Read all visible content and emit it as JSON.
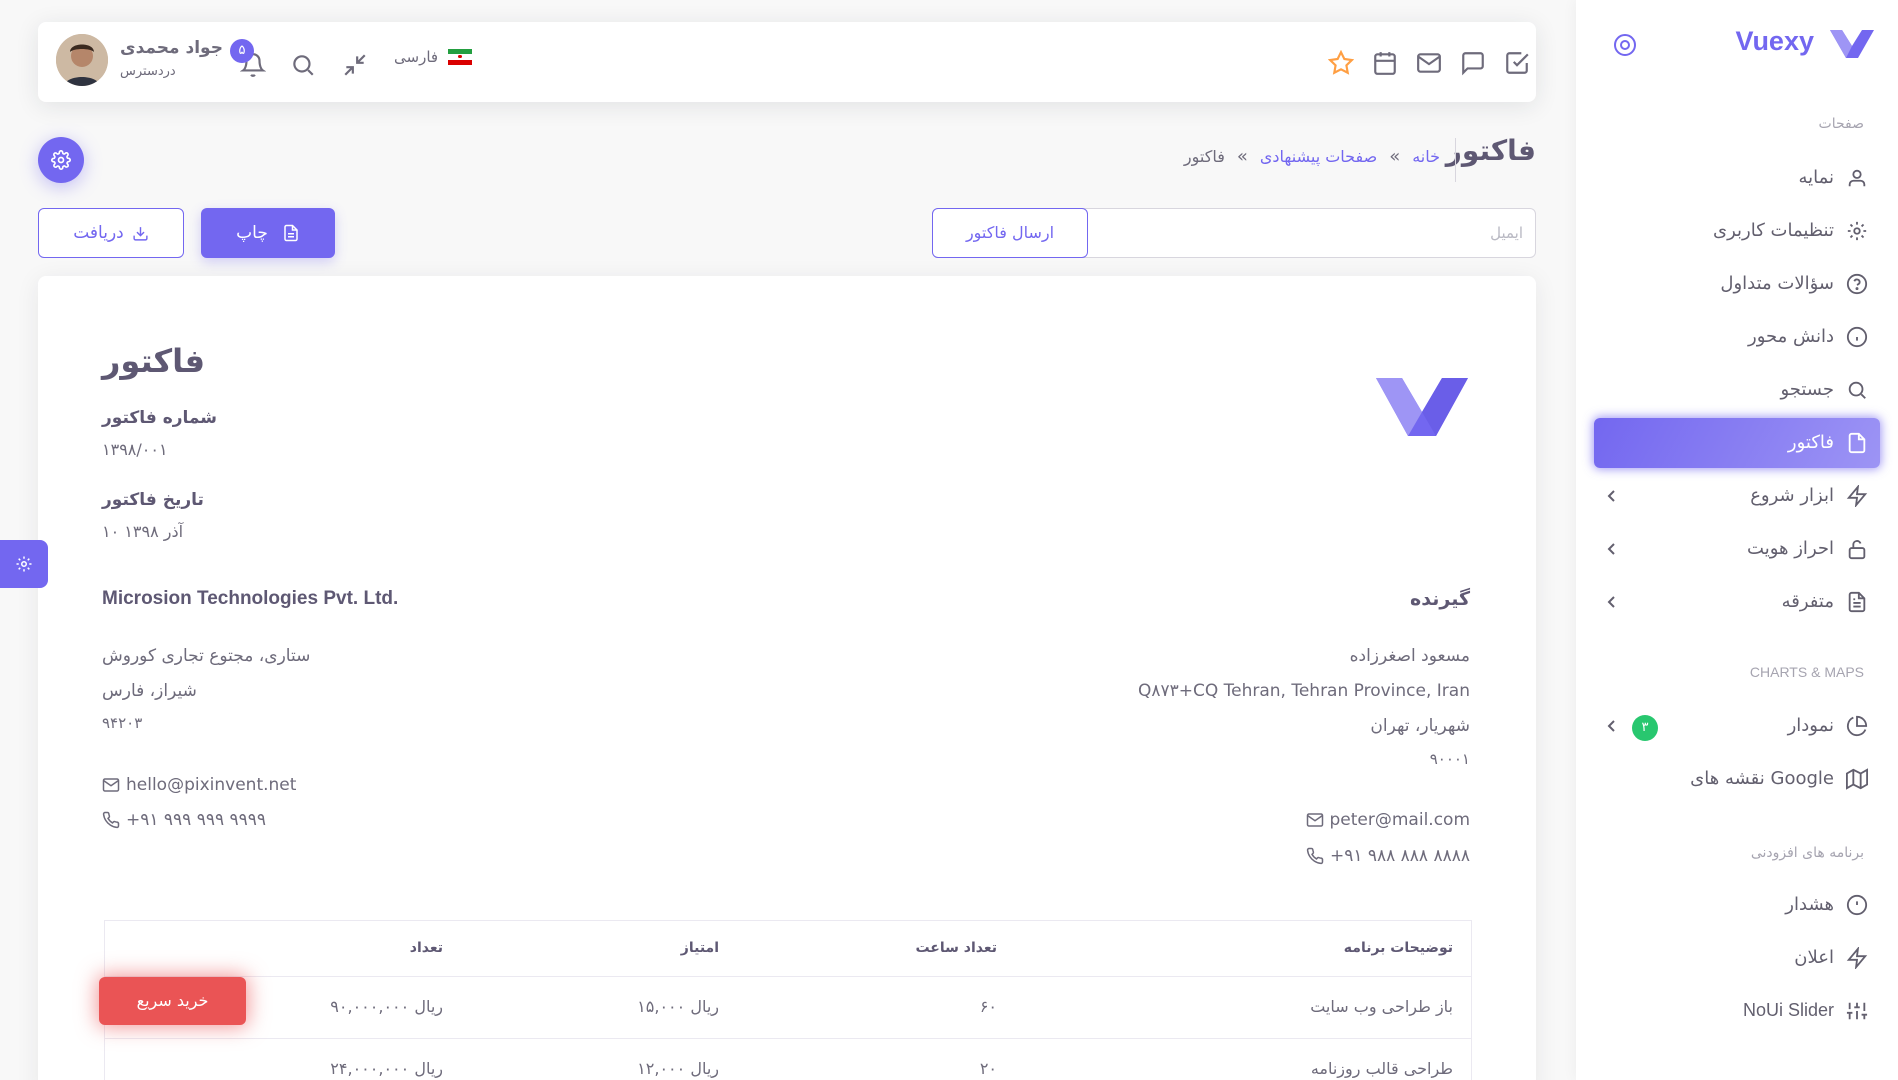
{
  "sidebar": {
    "brand": "Vuexy",
    "sections": {
      "pages": "صفحات",
      "charts": "CHARTS & MAPS",
      "extensions": "برنامه های افزودنی"
    },
    "items": [
      {
        "label": "نمایه"
      },
      {
        "label": "تنظیمات کاربری"
      },
      {
        "label": "سؤالات متداول"
      },
      {
        "label": "دانش محور"
      },
      {
        "label": "جستجو"
      },
      {
        "label": "فاکتور"
      },
      {
        "label": "ابزار شروع"
      },
      {
        "label": "احراز هویت"
      },
      {
        "label": "متفرقه"
      },
      {
        "label": "نمودار",
        "badge": "۳"
      },
      {
        "label": "نقشه های Google"
      },
      {
        "label": "هشدار"
      },
      {
        "label": "اعلان"
      },
      {
        "label": "NoUi Slider"
      }
    ]
  },
  "navbar": {
    "user_name": "جواد محمدی",
    "user_status": "دردسترس",
    "notifications": "۵",
    "language": "فارسی"
  },
  "page": {
    "title": "فاکتور",
    "breadcrumb": [
      "خانه",
      "صفحات پیشنهادی",
      "فاکتور"
    ]
  },
  "actions": {
    "email_placeholder": "ایمیل",
    "send": "ارسال فاکتور",
    "print": "چاپ",
    "download": "دریافت"
  },
  "invoice": {
    "title": "فاکتور",
    "number_label": "شماره فاکتور",
    "number": "۱۳۹۸/۰۰۱",
    "date_label": "تاریخ فاکتور",
    "date": "۱۰ آذر ۱۳۹۸",
    "company": {
      "name": "Microsion Technologies Pvt. Ltd.",
      "address1": "ستاری، مجتوع تجاری کوروش",
      "address2": "شیراز، فارس",
      "zip": "۹۴۲۰۳",
      "email": "hello@pixinvent.net",
      "phone": "+۹۱ ۹۹۹ ۹۹۹ ۹۹۹۹"
    },
    "recipient": {
      "heading": "گیرنده",
      "name": "مسعود اصغرزاده",
      "address1": "Q۸۷۳+CQ Tehran, Tehran Province, Iran",
      "address2": "شهریار، تهران",
      "zip": "۹۰۰۰۱",
      "email": "peter@mail.com",
      "phone": "+۹۱ ۹۸۸ ۸۸۸ ۸۸۸۸"
    },
    "table": {
      "headers": [
        "توضیحات برنامه",
        "تعداد ساعت",
        "امتیاز",
        "تعداد"
      ],
      "rows": [
        [
          "باز طراحی وب سایت",
          "۶۰",
          "۱۵,۰۰۰ ریال",
          "۹۰,۰۰۰,۰۰۰ ریال"
        ],
        [
          "طراحی قالب روزنامه",
          "۲۰",
          "۱۲,۰۰۰ ریال",
          "۲۴,۰۰۰,۰۰۰ ریال"
        ]
      ]
    }
  },
  "buy_now": "خرید سریع",
  "colors": {
    "primary": "#7367f0",
    "danger": "#ea5455",
    "success": "#28c76f"
  }
}
